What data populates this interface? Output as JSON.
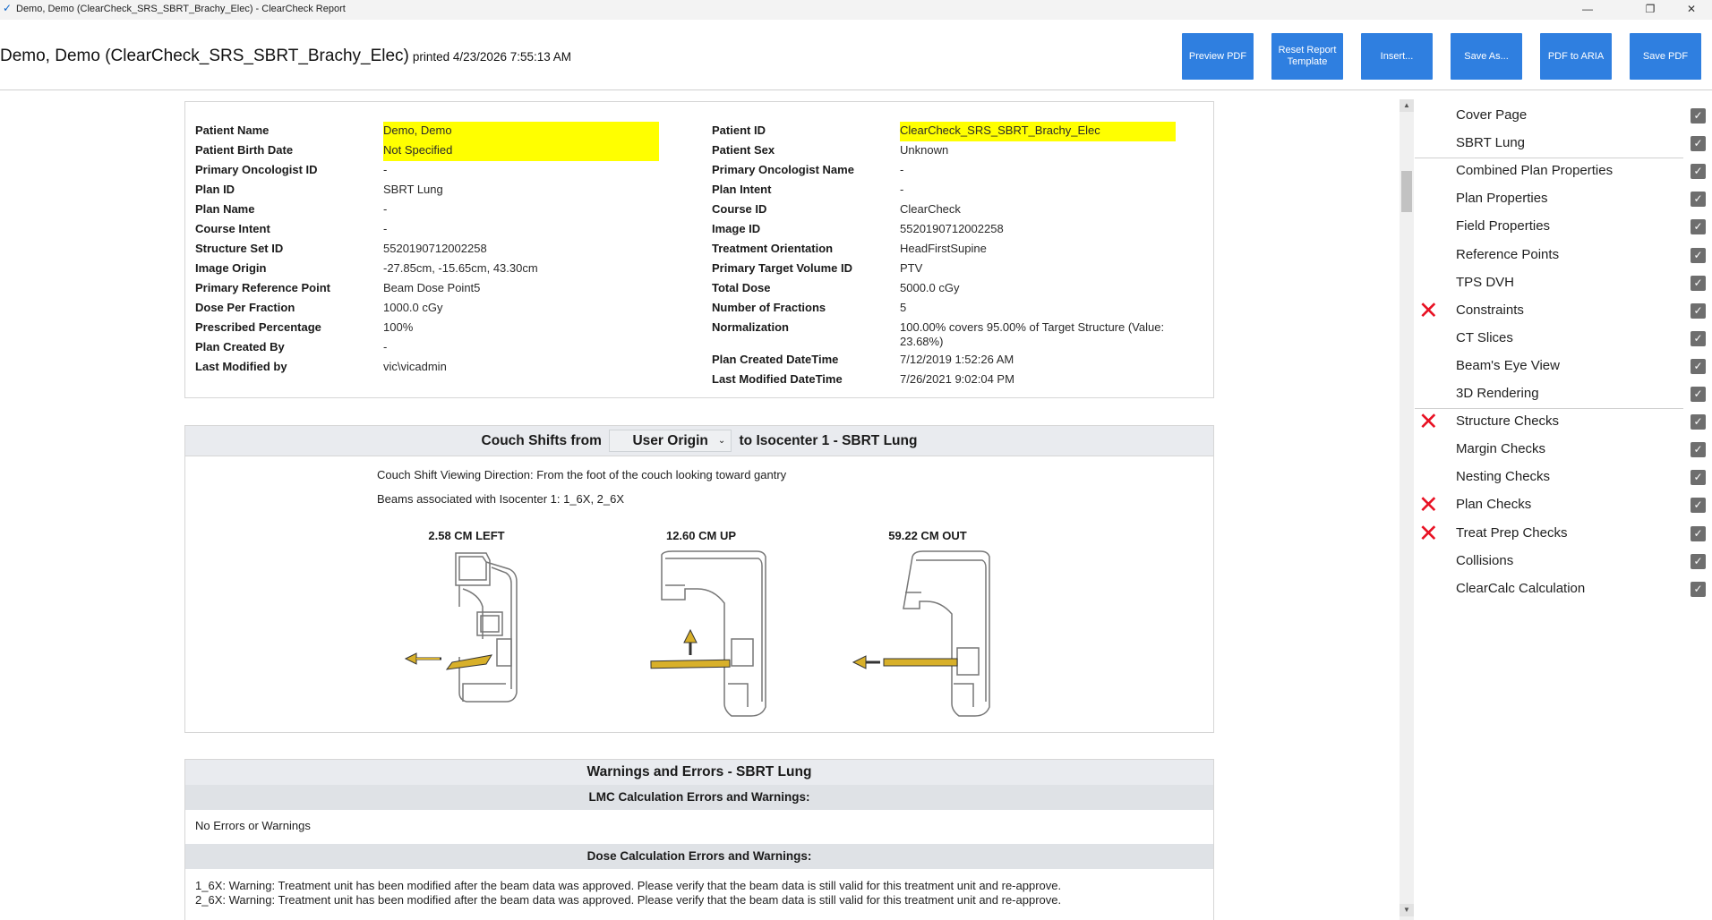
{
  "window": {
    "title": "Demo, Demo (ClearCheck_SRS_SBRT_Brachy_Elec) - ClearCheck Report",
    "minimize": "—",
    "restore": "❐",
    "close": "✕"
  },
  "header": {
    "title": "Demo, Demo (ClearCheck_SRS_SBRT_Brachy_Elec)",
    "printed": "printed 4/23/2026 7:55:13 AM",
    "buttons": {
      "preview_pdf": "Preview PDF",
      "reset_template": "Reset Report Template",
      "insert": "Insert...",
      "save_as": "Save As...",
      "pdf_to_aria": "PDF to ARIA",
      "save_pdf": "Save PDF"
    },
    "accent_color": "#2f7fe0"
  },
  "patient_info": {
    "left": [
      {
        "label": "Patient Name",
        "value": "Demo, Demo",
        "highlight": true
      },
      {
        "label": "Patient Birth Date",
        "value": "Not Specified",
        "highlight": true
      },
      {
        "label": "Primary Oncologist ID",
        "value": "-"
      },
      {
        "label": "Plan ID",
        "value": "SBRT Lung"
      },
      {
        "label": "Plan Name",
        "value": "-"
      },
      {
        "label": "Course Intent",
        "value": "-"
      },
      {
        "label": "Structure Set ID",
        "value": "5520190712002258"
      },
      {
        "label": "Image Origin",
        "value": "-27.85cm, -15.65cm, 43.30cm"
      },
      {
        "label": "Primary Reference Point",
        "value": "Beam Dose Point5"
      },
      {
        "label": "Dose Per Fraction",
        "value": "1000.0 cGy"
      },
      {
        "label": "Prescribed Percentage",
        "value": "100%"
      },
      {
        "label": "Plan Created By",
        "value": "-"
      },
      {
        "label": "Last Modified by",
        "value": "vic\\vicadmin"
      }
    ],
    "right": [
      {
        "label": "Patient ID",
        "value": "ClearCheck_SRS_SBRT_Brachy_Elec",
        "highlight": true
      },
      {
        "label": "Patient Sex",
        "value": "Unknown"
      },
      {
        "label": "Primary Oncologist Name",
        "value": " -"
      },
      {
        "label": "Plan Intent",
        "value": "-"
      },
      {
        "label": "Course ID",
        "value": "ClearCheck"
      },
      {
        "label": "Image ID",
        "value": "5520190712002258"
      },
      {
        "label": "Treatment Orientation",
        "value": "HeadFirstSupine"
      },
      {
        "label": "Primary Target Volume ID",
        "value": "PTV"
      },
      {
        "label": "Total Dose",
        "value": "5000.0 cGy"
      },
      {
        "label": "Number of Fractions",
        "value": "5"
      },
      {
        "label": "Normalization",
        "value": "100.00% covers 95.00% of Target Structure (Value:",
        "value2": "23.68%)"
      },
      {
        "label": "Plan Created DateTime",
        "value": "7/12/2019 1:52:26 AM"
      },
      {
        "label": "Last Modified DateTime",
        "value": "7/26/2021 9:02:04 PM"
      }
    ],
    "highlight_color": "#ffff00"
  },
  "couch_shifts": {
    "title_prefix": "Couch Shifts from",
    "origin_selected": "User Origin",
    "title_suffix": "to Isocenter 1 - SBRT Lung",
    "viewing_direction": "Couch Shift Viewing Direction: From the foot of the couch looking toward gantry",
    "beams": "Beams associated with Isocenter 1: 1_6X, 2_6X",
    "shifts": [
      "2.58 CM LEFT",
      "12.60 CM UP",
      "59.22 CM OUT"
    ],
    "arrow_color": "#d8b02a"
  },
  "warnings": {
    "title": "Warnings and Errors - SBRT Lung",
    "lmc_header": "LMC Calculation Errors and Warnings:",
    "lmc_text": "No Errors or Warnings",
    "dose_header": "Dose Calculation Errors and Warnings:",
    "dose_lines": [
      "1_6X: Warning: Treatment unit has been modified after the beam data was approved. Please verify that the beam data is still valid for this treatment unit and re-approve.",
      "2_6X: Warning: Treatment unit has been modified after the beam data was approved. Please verify that the beam data is still valid for this treatment unit and re-approve."
    ]
  },
  "sidebar": {
    "items": [
      {
        "label": "Cover Page",
        "checked": true,
        "error": false
      },
      {
        "label": "SBRT Lung",
        "checked": true,
        "error": false
      },
      {
        "label": "Combined Plan Properties",
        "checked": true,
        "error": false
      },
      {
        "label": "Plan Properties",
        "checked": true,
        "error": false
      },
      {
        "label": "Field Properties",
        "checked": true,
        "error": false
      },
      {
        "label": "Reference Points",
        "checked": true,
        "error": false
      },
      {
        "label": "TPS DVH",
        "checked": true,
        "error": false
      },
      {
        "label": "Constraints",
        "checked": true,
        "error": true
      },
      {
        "label": "CT Slices",
        "checked": true,
        "error": false
      },
      {
        "label": "Beam's Eye View",
        "checked": true,
        "error": false
      },
      {
        "label": "3D Rendering",
        "checked": true,
        "error": false
      },
      {
        "label": "Structure Checks",
        "checked": true,
        "error": true
      },
      {
        "label": "Margin Checks",
        "checked": true,
        "error": false
      },
      {
        "label": "Nesting Checks",
        "checked": true,
        "error": false
      },
      {
        "label": "Plan Checks",
        "checked": true,
        "error": true
      },
      {
        "label": "Treat Prep Checks",
        "checked": true,
        "error": true
      },
      {
        "label": "Collisions",
        "checked": true,
        "error": false
      },
      {
        "label": "ClearCalc Calculation",
        "checked": true,
        "error": false
      }
    ],
    "check_glyph": "✓",
    "error_glyph": "✕",
    "error_color": "#e81123"
  },
  "scrollbar": {
    "up": "▲",
    "down": "▼"
  }
}
